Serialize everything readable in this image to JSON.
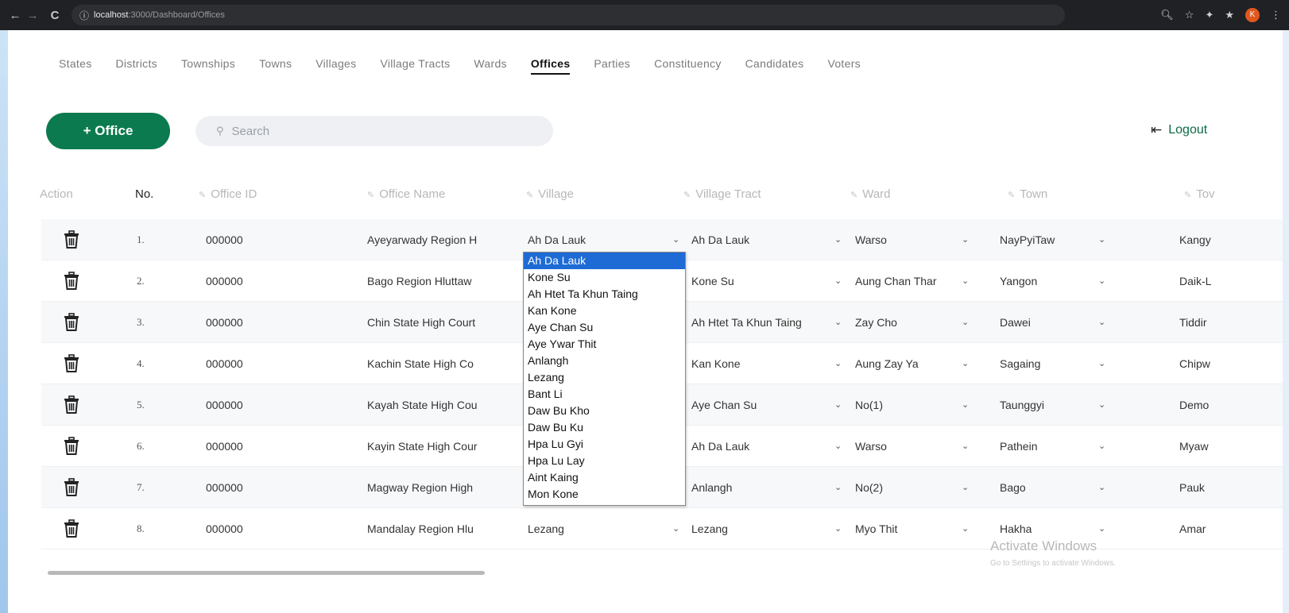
{
  "browser": {
    "url_host": "localhost",
    "url_path": ":3000/Dashboard/Offices",
    "profile_initial": "K"
  },
  "nav": {
    "tabs": [
      "States",
      "Districts",
      "Townships",
      "Towns",
      "Villages",
      "Village Tracts",
      "Wards",
      "Offices",
      "Parties",
      "Constituency",
      "Candidates",
      "Voters"
    ],
    "active": "Offices"
  },
  "toolbar": {
    "add_label": "+ Office",
    "search_placeholder": "Search",
    "logout_label": "Logout"
  },
  "table": {
    "headers": {
      "action": "Action",
      "no": "No.",
      "office_id": "Office ID",
      "office_name": "Office Name",
      "village": "Village",
      "village_tract": "Village Tract",
      "ward": "Ward",
      "town": "Town",
      "township": "Tov"
    },
    "rows": [
      {
        "no": "1.",
        "office_id": "000000",
        "office_name": "Ayeyarwady Region H",
        "village": "Ah Da Lauk",
        "village_tract": "Ah Da Lauk",
        "ward": "Warso",
        "town": "NayPyiTaw",
        "township": "Kangy"
      },
      {
        "no": "2.",
        "office_id": "000000",
        "office_name": "Bago Region Hluttaw",
        "village": "",
        "village_tract": "Kone Su",
        "ward": "Aung Chan Thar",
        "town": "Yangon",
        "township": "Daik-L"
      },
      {
        "no": "3.",
        "office_id": "000000",
        "office_name": "Chin State High Court",
        "village": "",
        "village_tract": "Ah Htet Ta Khun Taing",
        "ward": "Zay Cho",
        "town": "Dawei",
        "township": "Tiddir"
      },
      {
        "no": "4.",
        "office_id": "000000",
        "office_name": "Kachin State High Co",
        "village": "",
        "village_tract": "Kan Kone",
        "ward": "Aung Zay Ya",
        "town": "Sagaing",
        "township": "Chipw"
      },
      {
        "no": "5.",
        "office_id": "000000",
        "office_name": "Kayah State High Cou",
        "village": "",
        "village_tract": "Aye Chan Su",
        "ward": "No(1)",
        "town": "Taunggyi",
        "township": "Demo"
      },
      {
        "no": "6.",
        "office_id": "000000",
        "office_name": "Kayin State High Cour",
        "village": "",
        "village_tract": "Ah Da Lauk",
        "ward": "Warso",
        "town": "Pathein",
        "township": "Myaw"
      },
      {
        "no": "7.",
        "office_id": "000000",
        "office_name": "Magway Region High",
        "village": "",
        "village_tract": "Anlangh",
        "ward": "No(2)",
        "town": "Bago",
        "township": "Pauk"
      },
      {
        "no": "8.",
        "office_id": "000000",
        "office_name": "Mandalay Region Hlu",
        "village": "Lezang",
        "village_tract": "Lezang",
        "ward": "Myo Thit",
        "town": "Hakha",
        "township": "Amar"
      }
    ]
  },
  "village_dropdown": {
    "options": [
      "Ah Da Lauk",
      "Kone Su",
      "Ah Htet Ta Khun Taing",
      "Kan Kone",
      "Aye Chan Su",
      "Aye Ywar Thit",
      "Anlangh",
      "Lezang",
      "Bant Li",
      "Daw Bu Kho",
      "Daw Bu Ku",
      "Hpa Lu Gyi",
      "Hpa Lu Lay",
      "Aint Kaing",
      "Mon Kone"
    ],
    "selected": "Ah Da Lauk"
  },
  "watermark": {
    "title": "Activate Windows",
    "subtitle": "Go to Settings to activate Windows."
  }
}
